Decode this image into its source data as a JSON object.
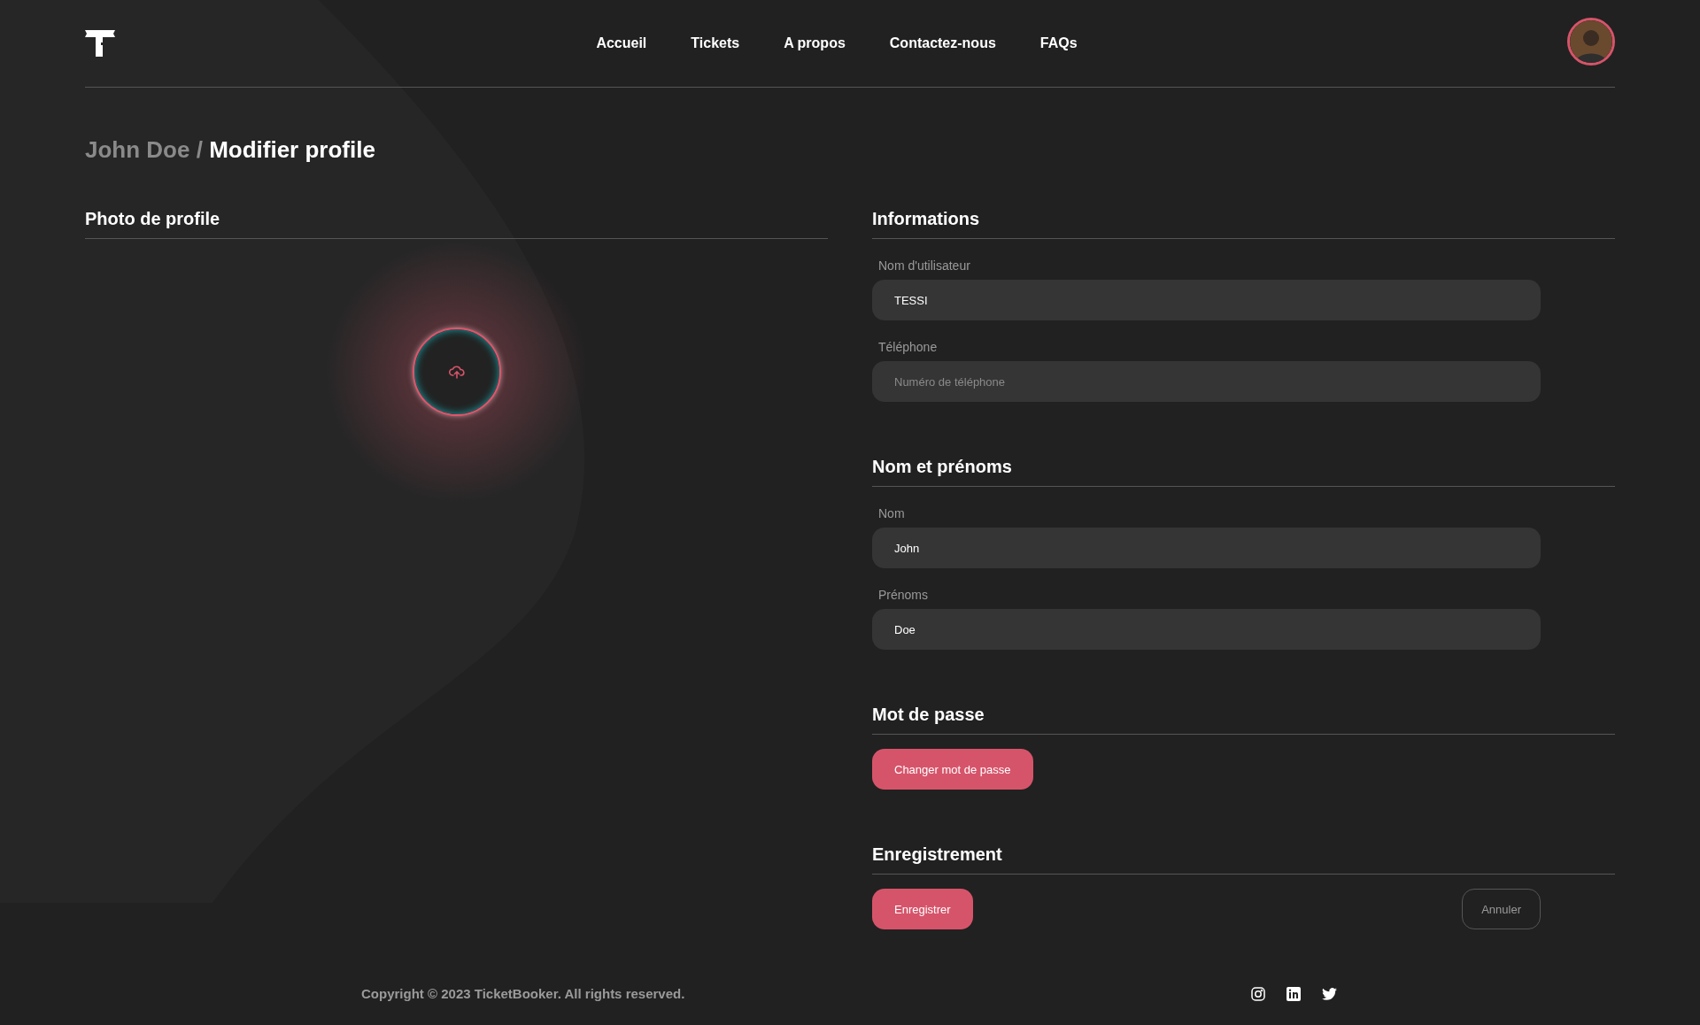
{
  "header": {
    "nav": [
      "Accueil",
      "Tickets",
      "A propos",
      "Contactez-nous",
      "FAQs"
    ]
  },
  "breadcrumb": {
    "parent": "John Doe",
    "separator": "/",
    "current": "Modifier profile"
  },
  "photo_section": {
    "title": "Photo de profile"
  },
  "sections": [
    {
      "title": "Informations",
      "kind": "fields",
      "fields": [
        {
          "label": "Nom d'utilisateur",
          "value": "TESSI"
        },
        {
          "label": "Téléphone",
          "placeholder": "Numéro de téléphone"
        }
      ]
    },
    {
      "title": "Nom et prénoms",
      "kind": "fields",
      "fields": [
        {
          "label": "Nom",
          "value": "John"
        },
        {
          "label": "Prénoms",
          "value": "Doe"
        }
      ]
    },
    {
      "title": "Mot de passe",
      "kind": "buttons",
      "buttons": [
        {
          "label": "Changer mot de passe",
          "kind": "primary"
        }
      ]
    },
    {
      "title": "Enregistrement",
      "kind": "buttons",
      "buttons": [
        {
          "label": "Enregistrer",
          "kind": "primary"
        },
        {
          "label": "Annuler",
          "kind": "outline"
        }
      ]
    }
  ],
  "footer": {
    "copyright": "Copyright © 2023 TicketBooker. All rights reserved."
  }
}
